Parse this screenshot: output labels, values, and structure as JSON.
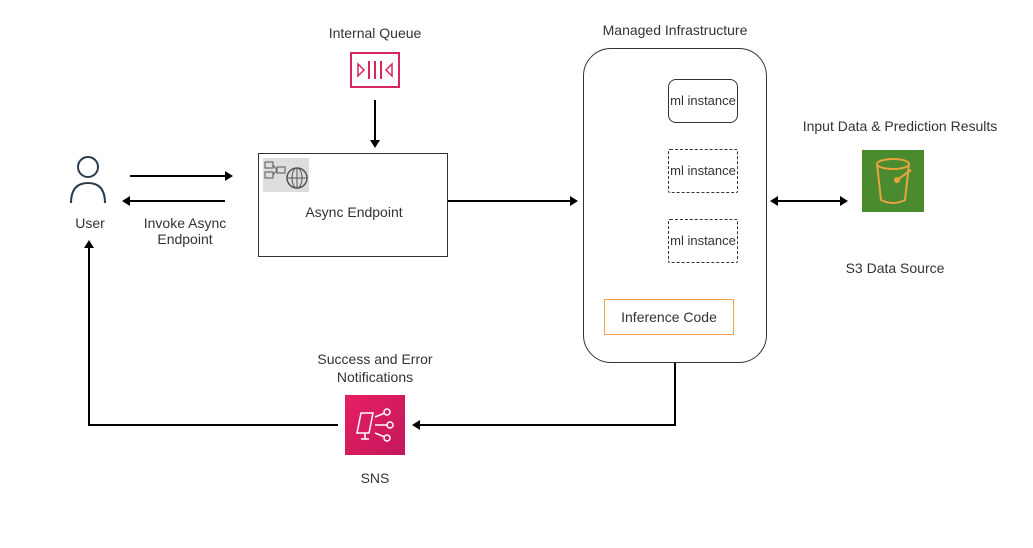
{
  "labels": {
    "internal_queue": "Internal Queue",
    "managed_infrastructure": "Managed Infrastructure",
    "input_data": "Input Data & Prediction Results",
    "user": "User",
    "invoke": "Invoke Async Endpoint",
    "async_endpoint": "Async Endpoint",
    "ml_instance": "ml instance",
    "inference_code": "Inference Code",
    "s3": "S3 Data Source",
    "success_error": "Success and Error Notifications",
    "sns": "SNS"
  }
}
